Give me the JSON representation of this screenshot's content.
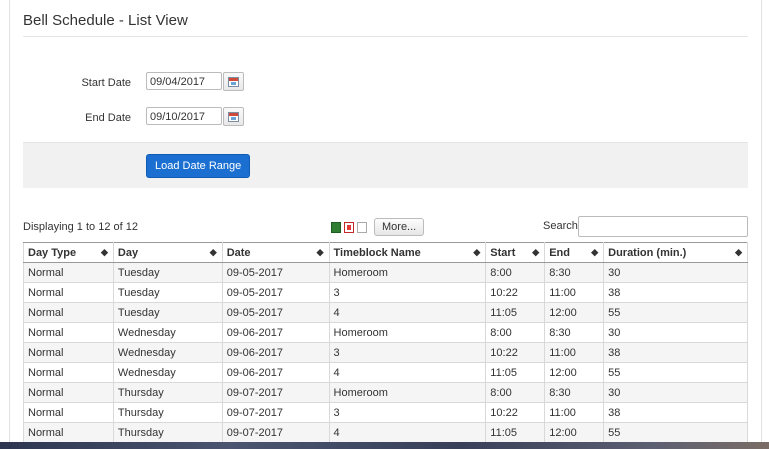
{
  "page": {
    "title": "Bell Schedule - List View"
  },
  "form": {
    "start_label": "Start Date",
    "start_value": "09/04/2017",
    "end_label": "End Date",
    "end_value": "09/10/2017",
    "load_button": "Load Date Range"
  },
  "toolbar": {
    "displaying": "Displaying 1 to 12 of 12",
    "more_label": "More...",
    "search_label": "Search",
    "search_value": ""
  },
  "table": {
    "columns": [
      "Day Type",
      "Day",
      "Date",
      "Timeblock Name",
      "Start",
      "End",
      "Duration (min.)"
    ],
    "rows": [
      [
        "Normal",
        "Tuesday",
        "09-05-2017",
        "Homeroom",
        "8:00",
        "8:30",
        "30"
      ],
      [
        "Normal",
        "Tuesday",
        "09-05-2017",
        "3",
        "10:22",
        "11:00",
        "38"
      ],
      [
        "Normal",
        "Tuesday",
        "09-05-2017",
        "4",
        "11:05",
        "12:00",
        "55"
      ],
      [
        "Normal",
        "Wednesday",
        "09-06-2017",
        "Homeroom",
        "8:00",
        "8:30",
        "30"
      ],
      [
        "Normal",
        "Wednesday",
        "09-06-2017",
        "3",
        "10:22",
        "11:00",
        "38"
      ],
      [
        "Normal",
        "Wednesday",
        "09-06-2017",
        "4",
        "11:05",
        "12:00",
        "55"
      ],
      [
        "Normal",
        "Thursday",
        "09-07-2017",
        "Homeroom",
        "8:00",
        "8:30",
        "30"
      ],
      [
        "Normal",
        "Thursday",
        "09-07-2017",
        "3",
        "10:22",
        "11:00",
        "38"
      ],
      [
        "Normal",
        "Thursday",
        "09-07-2017",
        "4",
        "11:05",
        "12:00",
        "55"
      ]
    ]
  },
  "icons": {
    "calendar": "calendar-icon",
    "excel": "excel-export-icon",
    "pdf": "pdf-export-icon",
    "doc": "document-export-icon",
    "sort": "sort-icon"
  },
  "colors": {
    "accent": "#1a6fd1",
    "stripe": "#f5f5f5"
  }
}
